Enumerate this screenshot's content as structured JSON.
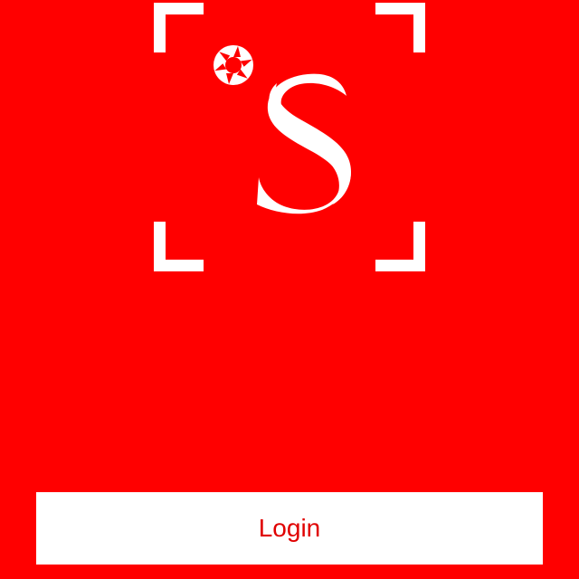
{
  "app": {
    "brand_letter": "S"
  },
  "login": {
    "label": "Login"
  },
  "theme": {
    "background": "#FF0000",
    "button_background": "#FFFFFF",
    "button_text": "#E00000",
    "logo_color": "#FFFFFF"
  },
  "icons": {
    "logo": "camera-shutter-s-logo-icon",
    "frame": "viewfinder-corners-icon"
  }
}
